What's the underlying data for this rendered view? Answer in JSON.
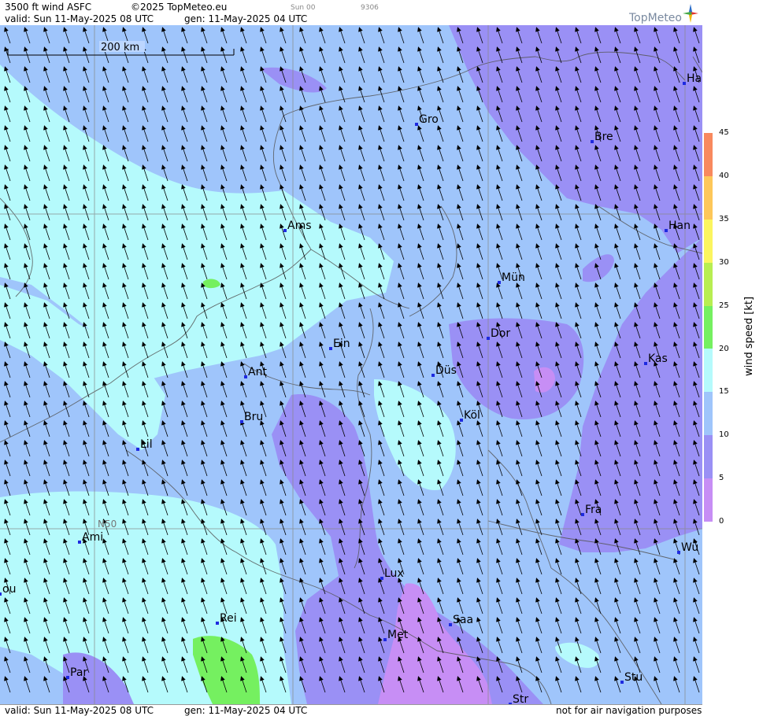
{
  "header": {
    "title": "3500 ft wind ASFC",
    "copyright": "©2025 TopMeteo.eu",
    "valid": "valid:  Sun  11-May-2025  08 UTC",
    "generated": "gen: 11-May-2025 04 UTC",
    "faint_day": "Sun 00",
    "faint_code": "9306",
    "logo": "TopMeteo"
  },
  "footer": {
    "valid": "valid:  Sun  11-May-2025  08 UTC",
    "generated": "gen: 11-May-2025 04 UTC",
    "disclaimer": "not for air navigation purposes"
  },
  "map": {
    "scale_label": "200 km",
    "lat_label": "N50",
    "cities": [
      {
        "name": "Gro"
      },
      {
        "name": "Bre"
      },
      {
        "name": "Ha"
      },
      {
        "name": "Han"
      },
      {
        "name": "Ams"
      },
      {
        "name": "Mün"
      },
      {
        "name": "Dor"
      },
      {
        "name": "Ein"
      },
      {
        "name": "Kas"
      },
      {
        "name": "Düs"
      },
      {
        "name": "Ant"
      },
      {
        "name": "Köl"
      },
      {
        "name": "Bru"
      },
      {
        "name": "Lil"
      },
      {
        "name": "Fra"
      },
      {
        "name": "Ami"
      },
      {
        "name": "Wü"
      },
      {
        "name": "Lux"
      },
      {
        "name": "ou"
      },
      {
        "name": "Rei"
      },
      {
        "name": "Saa"
      },
      {
        "name": "Met"
      },
      {
        "name": "Stu"
      },
      {
        "name": "Par"
      },
      {
        "name": "Str"
      }
    ],
    "wind_direction": "from south-east, arrows pointing north-north-west"
  },
  "colorbar": {
    "title": "wind speed [kt]",
    "ticks": [
      "45",
      "40",
      "35",
      "30",
      "25",
      "20",
      "15",
      "10",
      "5",
      "0"
    ],
    "colors": {
      "0-5": "#c78ef5",
      "5-10": "#9a90f5",
      "10-15": "#9fc5fb",
      "15-20": "#b5fafc",
      "20-25": "#75f060",
      "25-30": "#b8ee52",
      "30-35": "#fbf55f",
      "35-40": "#fdc75a",
      "40-45": "#f8895e"
    }
  }
}
